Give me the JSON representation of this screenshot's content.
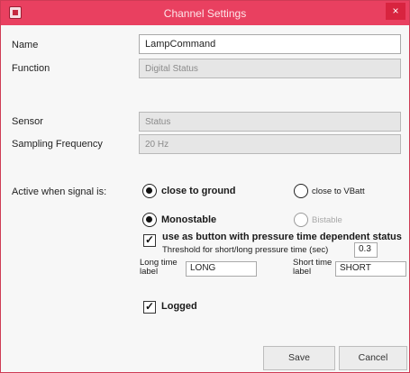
{
  "window": {
    "title": "Channel Settings",
    "close_label": "×",
    "accent_color": "#e94060"
  },
  "form": {
    "name": {
      "label": "Name",
      "value": "LampCommand"
    },
    "function": {
      "label": "Function",
      "value": "Digital Status"
    },
    "sensor": {
      "label": "Sensor",
      "value": "Status"
    },
    "sampling": {
      "label": "Sampling Frequency",
      "value": "20 Hz"
    },
    "active": {
      "label": "Active when signal is:",
      "options": [
        {
          "label": "close to ground",
          "selected": true
        },
        {
          "label": "close to VBatt",
          "selected": false
        }
      ]
    },
    "mode": {
      "options": [
        {
          "label": "Monostable",
          "selected": true
        },
        {
          "label": "Bistable",
          "selected": false,
          "disabled": true
        }
      ]
    },
    "button_mode": {
      "label": "use as button with pressure time dependent status",
      "checked": true,
      "threshold_label": "Threshold for short/long pressure time (sec)",
      "threshold_value": "0.3"
    },
    "long_label": {
      "label": "Long time label",
      "value": "LONG"
    },
    "short_label": {
      "label": "Short time label",
      "value": "SHORT"
    },
    "logged": {
      "label": "Logged",
      "checked": true
    }
  },
  "buttons": {
    "save": "Save",
    "cancel": "Cancel"
  }
}
